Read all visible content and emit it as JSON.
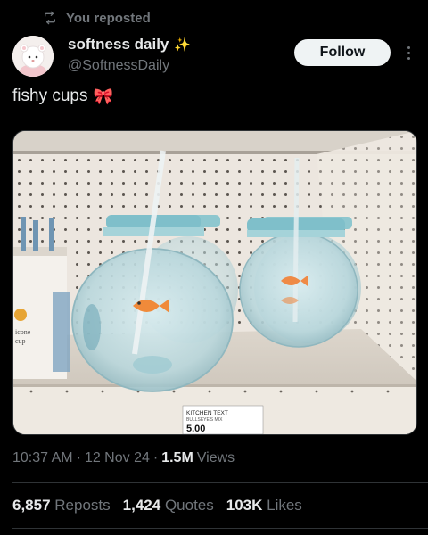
{
  "repost": {
    "label": "You reposted"
  },
  "author": {
    "display_name": "softness daily",
    "name_emoji": "✨",
    "handle": "@SoftnessDaily"
  },
  "follow_label": "Follow",
  "tweet": {
    "text": "fishy cups",
    "emoji": "🎀"
  },
  "media": {
    "shelf_tag_title": "KITCHEN TEXT",
    "shelf_tag_sub": "BULLSEYE'S MIX",
    "price": "5.00",
    "box_text_line1": "icone",
    "box_text_line2": "cup"
  },
  "meta": {
    "time": "10:37 AM",
    "sep1": "·",
    "date": "12 Nov 24",
    "sep2": "·",
    "views_count": "1.5M",
    "views_label": "Views"
  },
  "stats": {
    "reposts_count": "6,857",
    "reposts_label": "Reposts",
    "quotes_count": "1,424",
    "quotes_label": "Quotes",
    "likes_count": "103K",
    "likes_label": "Likes"
  },
  "colors": {
    "background": "#000000",
    "text": "#e7e9ea",
    "muted": "#71767b",
    "follow_bg": "#eff3f4"
  }
}
